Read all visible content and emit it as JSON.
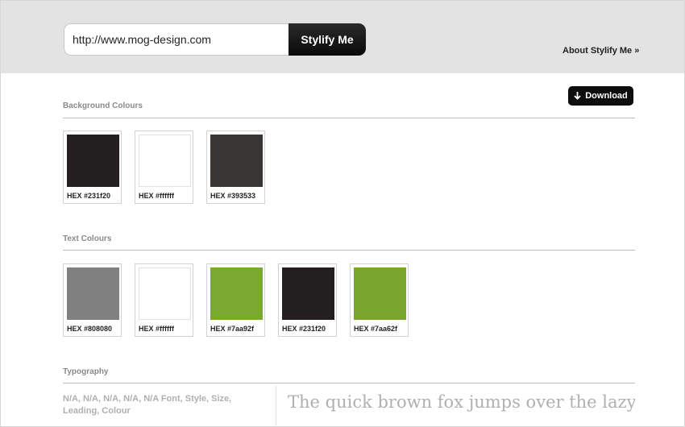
{
  "header": {
    "url_value": "http://www.mog-design.com",
    "submit_label": "Stylify Me",
    "about_label": "About Stylify Me »"
  },
  "download": {
    "label": "Download",
    "icon": "arrow-down-icon"
  },
  "background_colours": {
    "title": "Background Colours",
    "swatches": [
      {
        "label": "HEX #231f20",
        "color": "#231f20"
      },
      {
        "label": "HEX #ffffff",
        "color": "#ffffff"
      },
      {
        "label": "HEX #393533",
        "color": "#393533"
      }
    ]
  },
  "text_colours": {
    "title": "Text Colours",
    "swatches": [
      {
        "label": "HEX #808080",
        "color": "#808080"
      },
      {
        "label": "HEX #ffffff",
        "color": "#ffffff"
      },
      {
        "label": "HEX #7aa92f",
        "color": "#7aa92f"
      },
      {
        "label": "HEX #231f20",
        "color": "#231f20"
      },
      {
        "label": "HEX #7aa62f",
        "color": "#7aa62f"
      }
    ]
  },
  "typography": {
    "title": "Typography",
    "meta": "N/A, N/A, N/A, N/A, N/A Font, Style, Size, Leading, Colour",
    "sample": "The quick brown fox jumps over the lazy dog"
  }
}
